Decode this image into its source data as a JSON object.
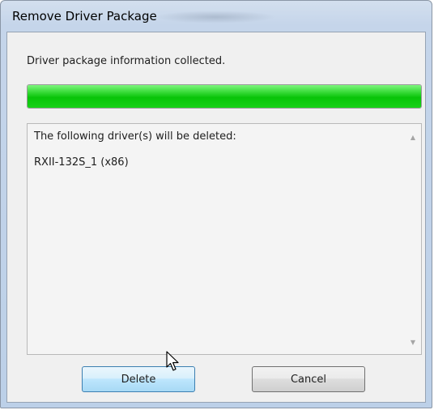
{
  "window": {
    "title": "Remove Driver Package"
  },
  "status": {
    "message": "Driver package information collected.",
    "progress_percent": 100,
    "progress_color": "#1ac81a"
  },
  "list": {
    "header": "The following driver(s) will be deleted:",
    "items": [
      "RXII-132S_1 (x86)"
    ],
    "scroll_up_icon": "scroll-up-arrow",
    "scroll_down_icon": "scroll-down-arrow"
  },
  "buttons": {
    "delete_label": "Delete",
    "cancel_label": "Cancel"
  },
  "colors": {
    "accent_hover_border": "#3c7fb1"
  }
}
